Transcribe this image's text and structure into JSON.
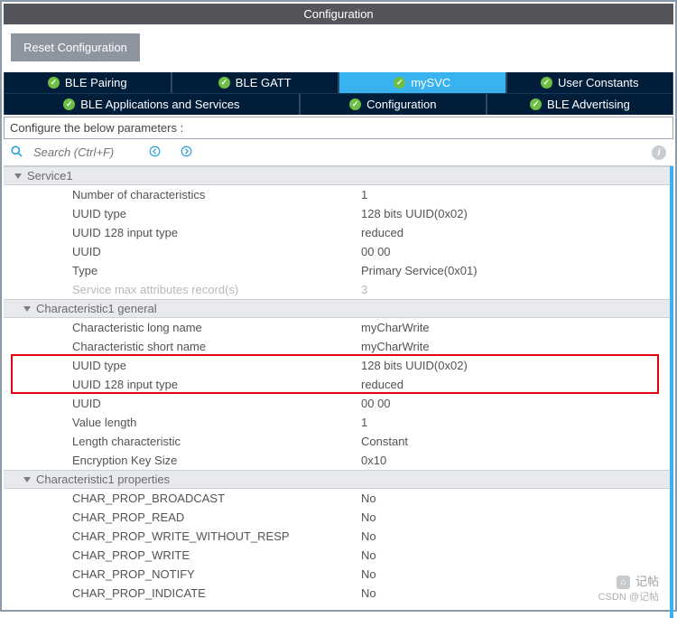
{
  "window": {
    "title": "Configuration"
  },
  "toolbar": {
    "reset_label": "Reset Configuration"
  },
  "tabs": {
    "row1": [
      {
        "label": "BLE Pairing",
        "active": false
      },
      {
        "label": "BLE GATT",
        "active": false
      },
      {
        "label": "mySVC",
        "active": true
      },
      {
        "label": "User Constants",
        "active": false
      }
    ],
    "row2": [
      {
        "label": "BLE Applications and Services",
        "active": false
      },
      {
        "label": "Configuration",
        "active": false
      },
      {
        "label": "BLE Advertising",
        "active": false
      }
    ]
  },
  "instruction": "Configure the below parameters :",
  "search": {
    "placeholder": "Search (Ctrl+F)"
  },
  "sections": [
    {
      "title": "Service1",
      "sub": false,
      "rows": [
        {
          "label": "Number of characteristics",
          "value": "1"
        },
        {
          "label": "UUID type",
          "value": "128 bits UUID(0x02)"
        },
        {
          "label": "UUID 128 input type",
          "value": "reduced"
        },
        {
          "label": "UUID",
          "value": "00 00"
        },
        {
          "label": "Type",
          "value": "Primary Service(0x01)"
        },
        {
          "label": "Service max attributes record(s)",
          "value": "3",
          "disabled": true
        }
      ]
    },
    {
      "title": "Characteristic1 general",
      "sub": true,
      "rows": [
        {
          "label": "Characteristic long name",
          "value": "myCharWrite"
        },
        {
          "label": "Characteristic short name",
          "value": "myCharWrite"
        },
        {
          "label": "UUID type",
          "value": "128 bits UUID(0x02)"
        },
        {
          "label": "UUID 128 input type",
          "value": "reduced"
        },
        {
          "label": "UUID",
          "value": "00 00"
        },
        {
          "label": "Value length",
          "value": "1"
        },
        {
          "label": "Length characteristic",
          "value": "Constant"
        },
        {
          "label": "Encryption Key Size",
          "value": "0x10"
        }
      ]
    },
    {
      "title": "Characteristic1 properties",
      "sub": true,
      "rows": [
        {
          "label": "CHAR_PROP_BROADCAST",
          "value": "No"
        },
        {
          "label": "CHAR_PROP_READ",
          "value": "No"
        },
        {
          "label": "CHAR_PROP_WRITE_WITHOUT_RESP",
          "value": "No"
        },
        {
          "label": "CHAR_PROP_WRITE",
          "value": "No"
        },
        {
          "label": "CHAR_PROP_NOTIFY",
          "value": "No"
        },
        {
          "label": "CHAR_PROP_INDICATE",
          "value": "No"
        }
      ]
    }
  ],
  "watermark": {
    "line1": "记帖",
    "line2": "CSDN @记帖"
  }
}
